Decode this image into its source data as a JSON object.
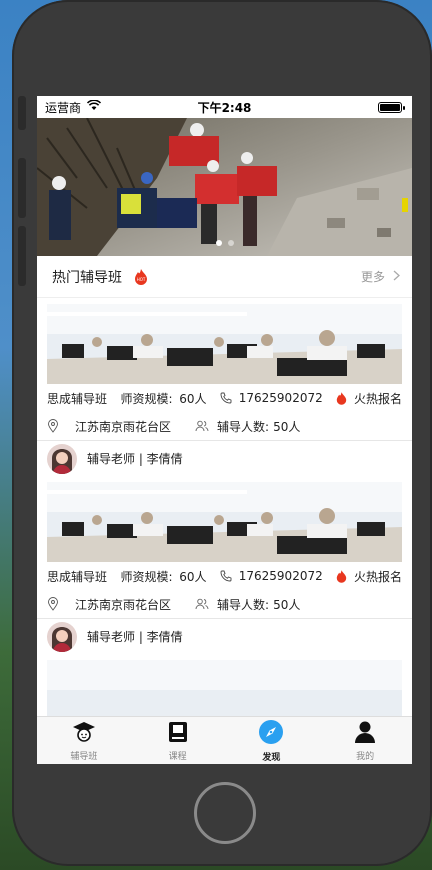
{
  "status": {
    "carrier": "运营商",
    "time": "下午2:48"
  },
  "banner": {
    "dot_count": 2,
    "active_dot": 0
  },
  "section": {
    "title": "热门辅导班",
    "more_label": "更多"
  },
  "cards": [
    {
      "name": "思成辅导班",
      "scale_label": "师资规模:",
      "scale_value": "60人",
      "phone": "17625902072",
      "hot_label": "火热报名",
      "address": "江苏南京雨花台区",
      "students_label": "辅导人数:",
      "students_value": "50人",
      "teacher": "辅导老师 | 李倩倩"
    },
    {
      "name": "思成辅导班",
      "scale_label": "师资规模:",
      "scale_value": "60人",
      "phone": "17625902072",
      "hot_label": "火热报名",
      "address": "江苏南京雨花台区",
      "students_label": "辅导人数:",
      "students_value": "50人",
      "teacher": "辅导老师 | 李倩倩"
    }
  ],
  "tabs": [
    {
      "label": "辅导班",
      "icon": "graduate-icon"
    },
    {
      "label": "课程",
      "icon": "book-icon"
    },
    {
      "label": "发现",
      "icon": "compass-icon",
      "active": true
    },
    {
      "label": "我的",
      "icon": "person-icon"
    }
  ],
  "colors": {
    "accent": "#2aa0f0",
    "hot": "#e8371f"
  }
}
